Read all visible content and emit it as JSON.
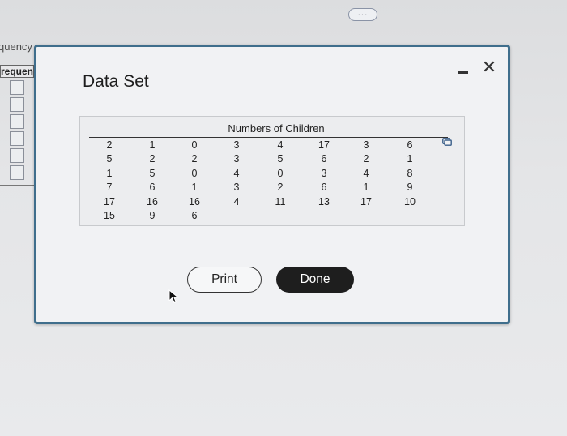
{
  "background": {
    "more_button": "...",
    "label_partial": "quency",
    "header_partial": "requen"
  },
  "dialog": {
    "title": "Data Set",
    "table": {
      "caption": "Numbers of Children",
      "columns": [
        [
          "2",
          "5",
          "1",
          "7",
          "17",
          "15"
        ],
        [
          "1",
          "2",
          "5",
          "6",
          "16",
          "9"
        ],
        [
          "0",
          "2",
          "0",
          "1",
          "16",
          "6"
        ],
        [
          "3",
          "3",
          "4",
          "3",
          "4"
        ],
        [
          "4",
          "5",
          "0",
          "2",
          "11"
        ],
        [
          "17",
          "6",
          "3",
          "6",
          "13"
        ],
        [
          "3",
          "2",
          "4",
          "1",
          "17"
        ],
        [
          "6",
          "1",
          "8",
          "9",
          "10"
        ]
      ]
    },
    "buttons": {
      "print": "Print",
      "done": "Done"
    }
  },
  "colors": {
    "dialog_border": "#3f6e8c",
    "done_bg": "#1e1e1e"
  }
}
